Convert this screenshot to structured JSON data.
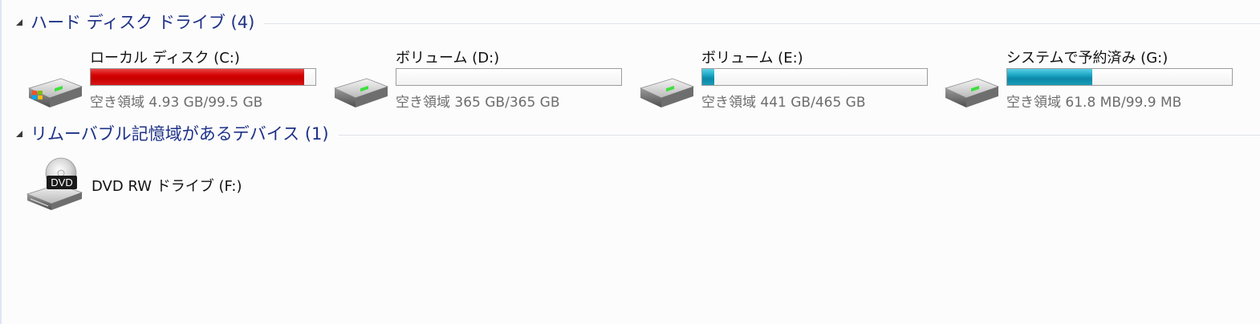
{
  "hard_disk_group": {
    "title": "ハード ディスク ドライブ (4)",
    "drives": [
      {
        "name": "ローカル ディスク (C:)",
        "free_text": "空き領域 4.93 GB/99.5 GB",
        "used_fraction": 0.95,
        "bar_color": "#d40000"
      },
      {
        "name": "ボリューム (D:)",
        "free_text": "空き領域 365 GB/365 GB",
        "used_fraction": 0.0,
        "bar_color": "#1aa4c2"
      },
      {
        "name": "ボリューム (E:)",
        "free_text": "空き領域 441 GB/465 GB",
        "used_fraction": 0.052,
        "bar_color": "#1aa4c2"
      },
      {
        "name": "システムで予約済み (G:)",
        "free_text": "空き領域 61.8 MB/99.9 MB",
        "used_fraction": 0.38,
        "bar_color": "#1aa4c2"
      }
    ]
  },
  "removable_group": {
    "title": "リムーバブル記憶域があるデバイス (1)",
    "devices": [
      {
        "name": "DVD RW ドライブ (F:)",
        "icon": "dvd-drive-icon",
        "icon_label": "DVD"
      }
    ]
  },
  "colors": {
    "group_title": "#1e3287",
    "free_text": "#6d6d6d"
  }
}
